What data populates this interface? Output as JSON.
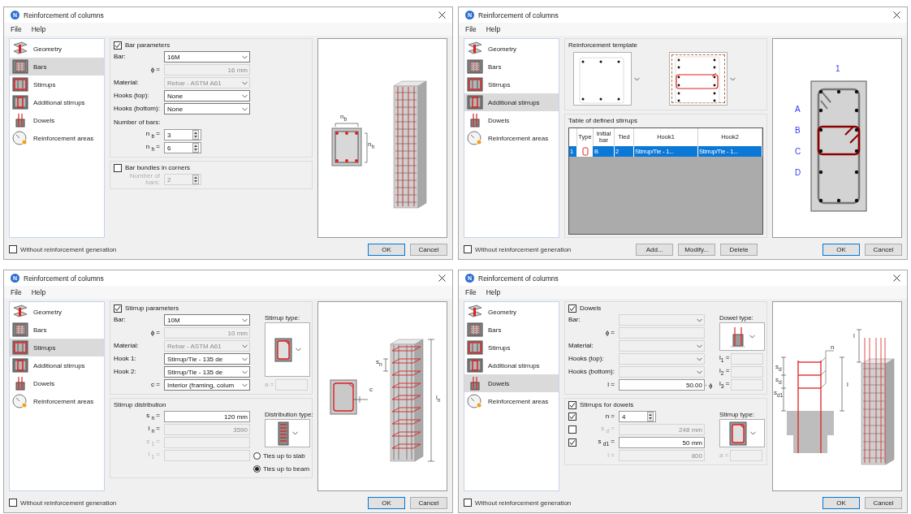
{
  "dialogs": [
    {
      "logo": "N",
      "title": "Reinforcement of columns",
      "menu": [
        "File",
        "Help"
      ],
      "sidebar": [
        {
          "label": "Geometry",
          "selected": false
        },
        {
          "label": "Bars",
          "selected": true
        },
        {
          "label": "Stirrups",
          "selected": false
        },
        {
          "label": "Additional stirrups",
          "selected": false
        },
        {
          "label": "Dowels",
          "selected": false
        },
        {
          "label": "Reinforcement areas",
          "selected": false
        }
      ],
      "panel": {
        "kind": "form",
        "groups": [
          {
            "title": "Bar parameters",
            "checked": true,
            "rows": [
              {
                "kind": "named",
                "label": "Bar:",
                "disabled": false,
                "field": {
                  "kind": "select",
                  "value": "16M",
                  "disabled": false
                }
              },
              {
                "kind": "symbol",
                "label": "ϕ =",
                "disabled": false,
                "field": {
                  "kind": "text",
                  "value": "16 mm",
                  "disabled": true
                }
              },
              {
                "kind": "named",
                "label": "Material:",
                "disabled": false,
                "field": {
                  "kind": "select",
                  "value": "Rebar - ASTM A61",
                  "disabled": true
                }
              },
              {
                "kind": "named",
                "label": "Hooks (top):",
                "disabled": false,
                "field": {
                  "kind": "select",
                  "value": "None",
                  "disabled": false
                }
              },
              {
                "kind": "named",
                "label": "Hooks (bottom):",
                "disabled": false,
                "field": {
                  "kind": "select",
                  "value": "None",
                  "disabled": false
                }
              },
              {
                "kind": "heading",
                "label": "Number of bars:"
              },
              {
                "kind": "symbol",
                "label": "n $_{b}$ =",
                "disabled": false,
                "field": {
                  "kind": "spin",
                  "value": "3",
                  "disabled": false
                }
              },
              {
                "kind": "symbol",
                "label": "n $_{h}$ =",
                "disabled": false,
                "field": {
                  "kind": "spin",
                  "value": "6",
                  "disabled": false
                }
              }
            ]
          },
          {
            "title": "Bar bundles in corners",
            "checked": false,
            "rows": [
              {
                "kind": "symbol",
                "label": "Number of bars:",
                "disabled": true,
                "field": {
                  "kind": "spin",
                  "value": "2",
                  "disabled": true
                }
              }
            ]
          }
        ]
      },
      "preview": {
        "kind": "bars",
        "labels": [
          "n$_{b}$",
          "n$_{h}$"
        ]
      },
      "footer": {
        "checkbox": {
          "label": "Without reinforcement generation",
          "checked": false
        },
        "buttons": [
          {
            "label": "OK",
            "kind": "default"
          },
          {
            "label": "Cancel",
            "kind": "normal"
          }
        ]
      }
    },
    {
      "logo": "N",
      "title": "Reinforcement of columns",
      "menu": [
        "File",
        "Help"
      ],
      "sidebar": [
        {
          "label": "Geometry",
          "selected": false
        },
        {
          "label": "Bars",
          "selected": false
        },
        {
          "label": "Stirrups",
          "selected": false
        },
        {
          "label": "Additional stirrups",
          "selected": true
        },
        {
          "label": "Dowels",
          "selected": false
        },
        {
          "label": "Reinforcement areas",
          "selected": false
        }
      ],
      "panel": {
        "kind": "templates",
        "template_title": "Reinforcement template",
        "templates": [
          {
            "kind": "corner",
            "selected": false
          },
          {
            "kind": "inner",
            "selected": true
          }
        ],
        "table_title": "Table of defined stirrups",
        "columns": [
          "Type",
          "Initial bar",
          "Tied",
          "Hook1",
          "Hook2"
        ],
        "rows": [
          {
            "number": "1",
            "selected": true,
            "cells": [
              "",
              "B",
              "2",
              "Stirrup/Tie - 1...",
              "Stirrup/Tie - 1..."
            ]
          }
        ]
      },
      "preview": {
        "kind": "section",
        "labels": [
          "1",
          "A",
          "B",
          "C",
          "D"
        ]
      },
      "footer": {
        "checkbox": {
          "label": "Without reinforcement generation",
          "checked": false
        },
        "buttons": [
          {
            "label": "Add...",
            "kind": "action"
          },
          {
            "label": "Modify...",
            "kind": "action"
          },
          {
            "label": "Delete",
            "kind": "action"
          },
          {
            "label": "OK",
            "kind": "default"
          },
          {
            "label": "Cancel",
            "kind": "normal"
          }
        ]
      }
    },
    {
      "logo": "N",
      "title": "Reinforcement of columns",
      "menu": [
        "File",
        "Help"
      ],
      "sidebar": [
        {
          "label": "Geometry",
          "selected": false
        },
        {
          "label": "Bars",
          "selected": false
        },
        {
          "label": "Stirrups",
          "selected": true
        },
        {
          "label": "Additional stirrups",
          "selected": false
        },
        {
          "label": "Dowels",
          "selected": false
        },
        {
          "label": "Reinforcement areas",
          "selected": false
        }
      ],
      "panel": {
        "kind": "form",
        "groups": [
          {
            "title": "Stirrup parameters",
            "checked": true,
            "picker": {
              "kind": "stirrup",
              "label": "Stirrup type:"
            },
            "rows": [
              {
                "kind": "named",
                "label": "Bar:",
                "disabled": false,
                "field": {
                  "kind": "select",
                  "value": "10M",
                  "disabled": false
                }
              },
              {
                "kind": "symbol",
                "label": "ϕ =",
                "disabled": false,
                "field": {
                  "kind": "text",
                  "value": "10 mm",
                  "disabled": true
                }
              },
              {
                "kind": "named",
                "label": "Material:",
                "disabled": false,
                "field": {
                  "kind": "select",
                  "value": "Rebar - ASTM A61",
                  "disabled": true
                }
              },
              {
                "kind": "named",
                "label": "Hook 1:",
                "disabled": false,
                "field": {
                  "kind": "select",
                  "value": "Stirrup/Tie - 135 de",
                  "disabled": false
                }
              },
              {
                "kind": "named",
                "label": "Hook 2:",
                "disabled": false,
                "field": {
                  "kind": "select",
                  "value": "Stirrup/Tie - 135 de",
                  "disabled": false
                }
              },
              {
                "kind": "symbol",
                "label": "c =",
                "disabled": false,
                "field": {
                  "kind": "select",
                  "value": "Interior (framing, colum",
                  "disabled": false
                },
                "side": {
                  "kind": "field",
                  "label": "a =",
                  "disabled": true,
                  "field": {
                    "kind": "text",
                    "disabled": true
                  }
                }
              }
            ]
          },
          {
            "title": "Stirrup distribution",
            "picker": {
              "kind": "distribution",
              "label": "Distribution type:"
            },
            "rows": [
              {
                "kind": "symbol",
                "label": "s $_{n}$ =",
                "disabled": false,
                "field": {
                  "kind": "text",
                  "value": "120 mm",
                  "disabled": false
                }
              },
              {
                "kind": "symbol",
                "label": "l $_{n}$ =",
                "disabled": false,
                "field": {
                  "kind": "text",
                  "value": "3590",
                  "disabled": true
                }
              },
              {
                "kind": "symbol",
                "label": "s $_{1}$ =",
                "disabled": true,
                "field": {
                  "kind": "text",
                  "disabled": true
                }
              },
              {
                "kind": "symbol",
                "label": "l $_{1}$ =",
                "disabled": true,
                "field": {
                  "kind": "text",
                  "disabled": true
                },
                "side": {
                  "kind": "radio",
                  "label": "Ties up to slab",
                  "selected": false
                }
              },
              {
                "kind": "side_only",
                "side": {
                  "kind": "radio",
                  "label": "Ties up to beam",
                  "selected": true
                }
              }
            ]
          }
        ]
      },
      "preview": {
        "kind": "stirrups",
        "labels": [
          "c",
          "s$_{n}$",
          "l$_{n}$"
        ]
      },
      "footer": {
        "checkbox": {
          "label": "Without reinforcement generation",
          "checked": false
        },
        "buttons": [
          {
            "label": "OK",
            "kind": "default"
          },
          {
            "label": "Cancel",
            "kind": "normal"
          }
        ]
      }
    },
    {
      "logo": "N",
      "title": "Reinforcement of columns",
      "menu": [
        "File",
        "Help"
      ],
      "sidebar": [
        {
          "label": "Geometry",
          "selected": false
        },
        {
          "label": "Bars",
          "selected": false
        },
        {
          "label": "Stirrups",
          "selected": false
        },
        {
          "label": "Additional stirrups",
          "selected": false
        },
        {
          "label": "Dowels",
          "selected": true
        },
        {
          "label": "Reinforcement areas",
          "selected": false
        }
      ],
      "panel": {
        "kind": "form",
        "groups": [
          {
            "title": "Dowels",
            "checked": true,
            "picker": {
              "kind": "dowel",
              "label": "Dowel type:"
            },
            "rows": [
              {
                "kind": "named",
                "label": "Bar:",
                "disabled": false,
                "field": {
                  "kind": "select",
                  "disabled": true
                }
              },
              {
                "kind": "symbol",
                "label": "ϕ =",
                "disabled": false,
                "field": {
                  "kind": "text",
                  "disabled": true
                }
              },
              {
                "kind": "named",
                "label": "Material:",
                "disabled": false,
                "field": {
                  "kind": "select",
                  "disabled": true
                }
              },
              {
                "kind": "named",
                "label": "Hooks (top):",
                "disabled": false,
                "field": {
                  "kind": "select",
                  "disabled": true
                },
                "side": {
                  "kind": "field",
                  "label": "l$_{1}$ =",
                  "disabled": false,
                  "field": {
                    "kind": "text",
                    "disabled": true
                  }
                }
              },
              {
                "kind": "named",
                "label": "Hooks (bottom):",
                "disabled": false,
                "field": {
                  "kind": "select",
                  "disabled": true
                },
                "side": {
                  "kind": "field",
                  "label": "l$_{2}$ =",
                  "disabled": false,
                  "field": {
                    "kind": "text",
                    "disabled": true
                  }
                }
              },
              {
                "kind": "symbol",
                "label": "l =",
                "disabled": false,
                "field": {
                  "kind": "text",
                  "value": "50.00",
                  "disabled": false
                },
                "suffix": "· ϕ",
                "side": {
                  "kind": "field",
                  "label": "l$_{3}$ =",
                  "disabled": false,
                  "field": {
                    "kind": "text",
                    "disabled": true
                  }
                }
              }
            ]
          },
          {
            "title": "Stirrups for dowels",
            "checked": true,
            "picker": {
              "kind": "stirrup",
              "label": "Stirrup type:"
            },
            "rows": [
              {
                "kind": "symbol",
                "label": "n =",
                "checked": true,
                "disabled": false,
                "field": {
                  "kind": "spin",
                  "value": "4",
                  "disabled": false
                }
              },
              {
                "kind": "symbol",
                "label": "s $_{d}$ =",
                "checked": false,
                "disabled": true,
                "field": {
                  "kind": "text",
                  "value": "248 mm",
                  "disabled": true
                }
              },
              {
                "kind": "symbol",
                "label": "s $_{d1}$ =",
                "checked": true,
                "disabled": false,
                "field": {
                  "kind": "text",
                  "value": "50 mm",
                  "disabled": false
                }
              },
              {
                "kind": "symbol",
                "label": "l =",
                "disabled": true,
                "field": {
                  "kind": "text",
                  "value": "800",
                  "disabled": true
                },
                "side": {
                  "kind": "field",
                  "label": "a =",
                  "disabled": true,
                  "field": {
                    "kind": "text",
                    "disabled": true
                  }
                }
              }
            ]
          }
        ]
      },
      "preview": {
        "kind": "dowels",
        "labels": [
          "n",
          "s$_{d}$",
          "s$_{d}$",
          "s$_{d1}$",
          "l",
          "l"
        ]
      },
      "footer": {
        "checkbox": {
          "label": "Without reinforcement generation",
          "checked": false
        },
        "buttons": [
          {
            "label": "OK",
            "kind": "default"
          },
          {
            "label": "Cancel",
            "kind": "normal"
          }
        ]
      }
    }
  ]
}
